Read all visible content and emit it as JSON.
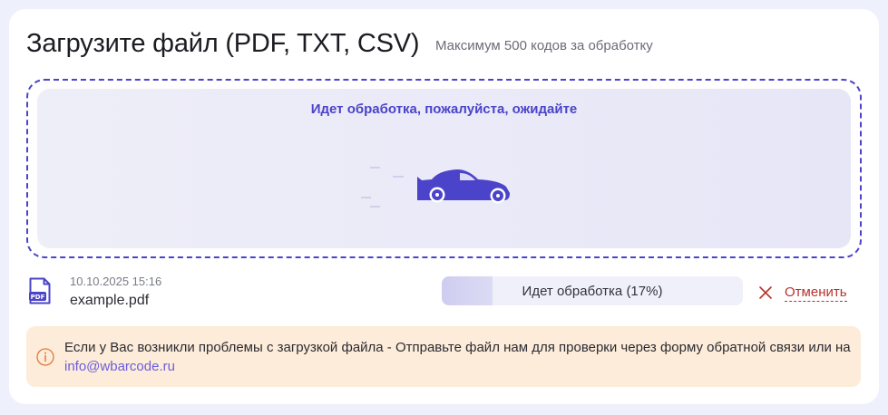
{
  "upload": {
    "title": "Загрузите файл (PDF, TXT, CSV)",
    "subtitle": "Максимум 500 кодов за обработку"
  },
  "dropzone": {
    "processing_message": "Идет обработка, пожалуйста, ожидайте",
    "animation_icon": "car-icon"
  },
  "file": {
    "icon": "pdf-file-icon",
    "icon_label": "PDF",
    "date": "10.10.2025 15:16",
    "name": "example.pdf"
  },
  "progress": {
    "percent": 17,
    "label": "Идет обработка (17%)"
  },
  "cancel": {
    "label": "Отменить",
    "icon": "close-icon"
  },
  "notice": {
    "icon": "info-icon",
    "text": "Если у Вас возникли проблемы с загрузкой файла - Отправьте файл нам для проверки через форму обратной связи или на ",
    "link": "info@wbarcode.ru"
  },
  "colors": {
    "accent": "#4b43c9",
    "danger": "#b8322e",
    "notice_bg": "#fdecd9",
    "notice_accent": "#e07a3c",
    "link": "#6a5ddc"
  }
}
